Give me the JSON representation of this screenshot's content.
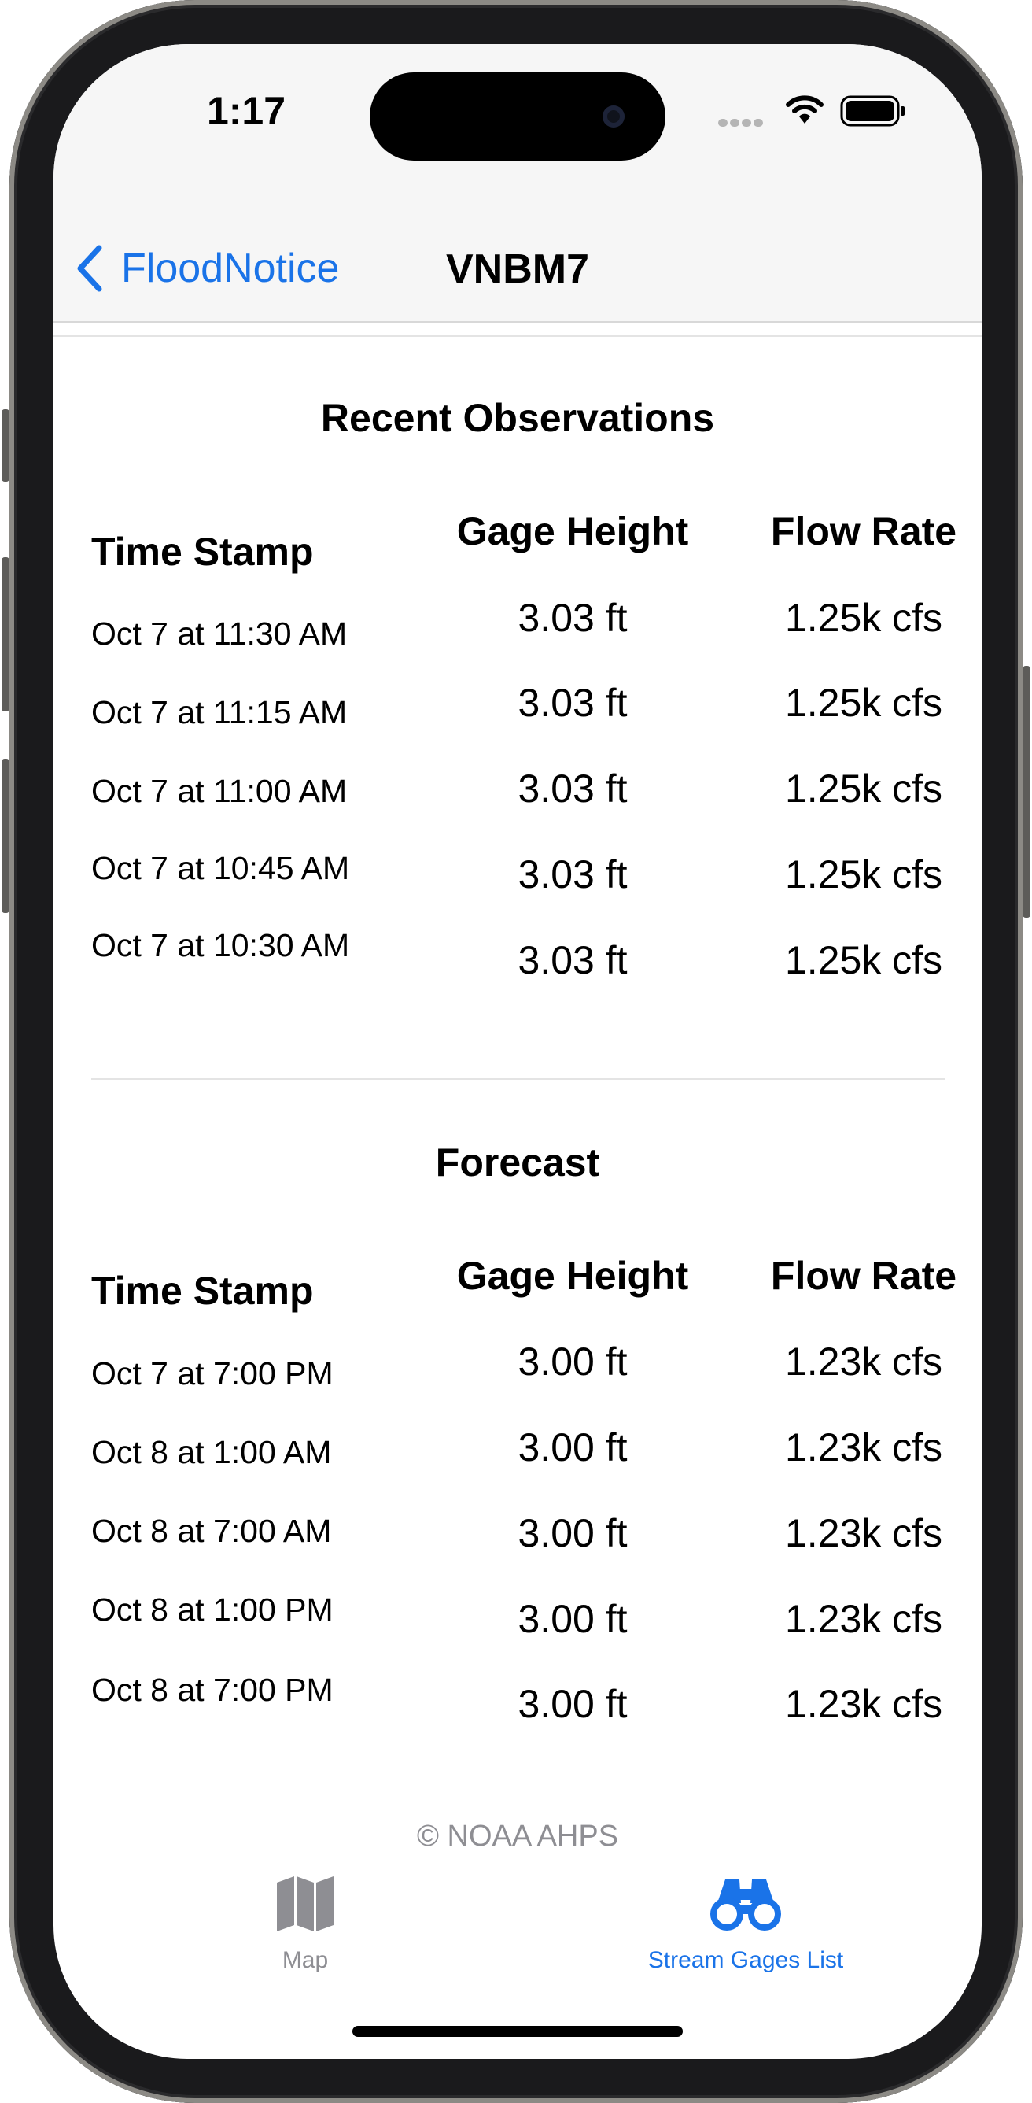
{
  "status_bar": {
    "time": "1:17"
  },
  "nav": {
    "back_label": "FloodNotice",
    "title": "VNBM7"
  },
  "columns": {
    "time_stamp": "Time Stamp",
    "gage_height": "Gage Height",
    "flow_rate": "Flow Rate"
  },
  "observations": {
    "title": "Recent Observations",
    "rows": [
      {
        "time": "Oct 7 at 11:30 AM",
        "gage": "3.03 ft",
        "flow": "1.25k cfs"
      },
      {
        "time": "Oct 7 at 11:15 AM",
        "gage": "3.03 ft",
        "flow": "1.25k cfs"
      },
      {
        "time": "Oct 7 at 11:00 AM",
        "gage": "3.03 ft",
        "flow": "1.25k cfs"
      },
      {
        "time": "Oct 7 at 10:45 AM",
        "gage": "3.03 ft",
        "flow": "1.25k cfs"
      },
      {
        "time": "Oct 7 at 10:30 AM",
        "gage": "3.03 ft",
        "flow": "1.25k cfs"
      }
    ]
  },
  "forecast": {
    "title": "Forecast",
    "rows": [
      {
        "time": "Oct 7 at 7:00 PM",
        "gage": "3.00 ft",
        "flow": "1.23k cfs"
      },
      {
        "time": "Oct 8 at 1:00 AM",
        "gage": "3.00 ft",
        "flow": "1.23k cfs"
      },
      {
        "time": "Oct 8 at 7:00 AM",
        "gage": "3.00 ft",
        "flow": "1.23k cfs"
      },
      {
        "time": "Oct 8 at 1:00 PM",
        "gage": "3.00 ft",
        "flow": "1.23k cfs"
      },
      {
        "time": "Oct 8 at 7:00 PM",
        "gage": "3.00 ft",
        "flow": "1.23k cfs"
      }
    ]
  },
  "footer": {
    "copyright": "© NOAA AHPS"
  },
  "tabs": [
    {
      "label": "Map",
      "icon": "map-icon",
      "selected": false
    },
    {
      "label": "Stream Gages List",
      "icon": "binoculars-icon",
      "selected": true
    }
  ],
  "colors": {
    "accent": "#1a73e8",
    "inactive": "#8e8e93",
    "bar_bg": "#f6f6f6"
  }
}
